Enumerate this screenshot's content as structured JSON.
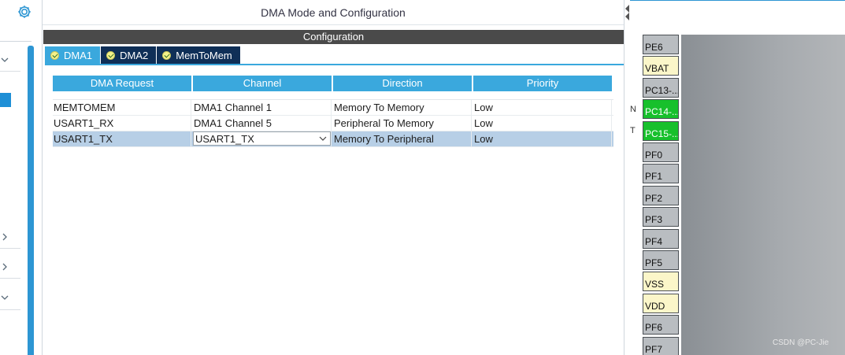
{
  "dialog": {
    "title": "DMA Mode and Configuration",
    "config_header": "Configuration",
    "tabs": [
      {
        "label": "DMA1",
        "active": true
      },
      {
        "label": "DMA2",
        "active": false
      },
      {
        "label": "MemToMem",
        "active": false
      }
    ]
  },
  "table": {
    "columns": [
      "DMA Request",
      "Channel",
      "Direction",
      "Priority"
    ],
    "rows": [
      {
        "request": "MEMTOMEM",
        "channel": "DMA1 Channel 1",
        "direction": "Memory To Memory",
        "priority": "Low",
        "selected": false
      },
      {
        "request": "USART1_RX",
        "channel": "DMA1 Channel 5",
        "direction": "Peripheral To Memory",
        "priority": "Low",
        "selected": false
      },
      {
        "request": "USART1_TX",
        "channel": "USART1_TX",
        "direction": "Memory To Peripheral",
        "priority": "Low",
        "selected": true
      }
    ]
  },
  "chip": {
    "pins": [
      {
        "label": "PE6",
        "state": "gray"
      },
      {
        "label": "VBAT",
        "state": "yellow"
      },
      {
        "label": "PC13-...",
        "state": "gray"
      },
      {
        "label": "PC14-...",
        "state": "green"
      },
      {
        "label": "PC15-...",
        "state": "green"
      },
      {
        "label": "PF0",
        "state": "gray"
      },
      {
        "label": "PF1",
        "state": "gray"
      },
      {
        "label": "PF2",
        "state": "gray"
      },
      {
        "label": "PF3",
        "state": "gray"
      },
      {
        "label": "PF4",
        "state": "gray"
      },
      {
        "label": "PF5",
        "state": "gray"
      },
      {
        "label": "VSS",
        "state": "yellow"
      },
      {
        "label": "VDD",
        "state": "yellow"
      },
      {
        "label": "PF6",
        "state": "gray"
      },
      {
        "label": "PF7",
        "state": "gray"
      }
    ],
    "stub_labels": [
      "N",
      "T"
    ]
  },
  "watermark": "CSDN @PC-Jie",
  "colors": {
    "accent": "#3aa8dd",
    "tab_dark": "#0f2f57",
    "selected_row": "#b7cfe6",
    "pin_green": "#17c02c",
    "pin_yellow": "#fbf6c9"
  }
}
